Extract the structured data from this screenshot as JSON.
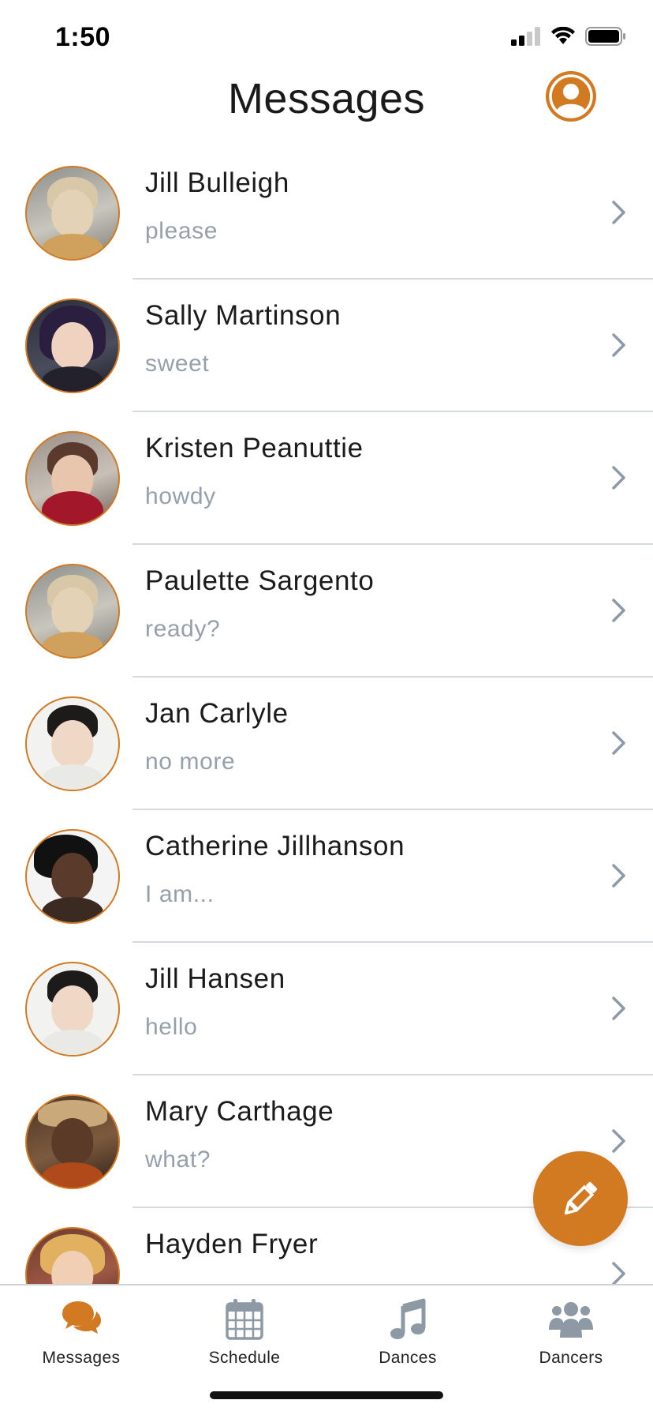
{
  "status_bar": {
    "time": "1:50",
    "icons": [
      "cellular-signal-icon",
      "wifi-icon",
      "battery-icon"
    ]
  },
  "header": {
    "title": "Messages",
    "profile_icon": "user-profile-icon"
  },
  "colors": {
    "accent": "#d17a22",
    "name_text": "#1b1b1b",
    "preview_text": "#95a0ab",
    "chevron": "#8e99a6",
    "divider": "#d6d9de",
    "tab_icon_inactive": "#8e99a6"
  },
  "conversations": [
    {
      "name": "Jill Bulleigh",
      "preview": "please"
    },
    {
      "name": "Sally Martinson",
      "preview": "sweet"
    },
    {
      "name": "Kristen Peanuttie",
      "preview": "howdy"
    },
    {
      "name": "Paulette Sargento",
      "preview": "ready?"
    },
    {
      "name": "Jan Carlyle",
      "preview": "no more"
    },
    {
      "name": "Catherine Jillhanson",
      "preview": "I am..."
    },
    {
      "name": "Jill Hansen",
      "preview": "hello"
    },
    {
      "name": "Mary Carthage",
      "preview": "what?"
    },
    {
      "name": "Hayden Fryer",
      "preview": ""
    }
  ],
  "compose_button": {
    "icon": "pencil-icon"
  },
  "tabbar": {
    "tabs": [
      {
        "label": "Messages",
        "icon": "chat-bubbles-icon",
        "active": true
      },
      {
        "label": "Schedule",
        "icon": "calendar-icon",
        "active": false
      },
      {
        "label": "Dances",
        "icon": "music-note-icon",
        "active": false
      },
      {
        "label": "Dancers",
        "icon": "group-icon",
        "active": false
      }
    ]
  }
}
